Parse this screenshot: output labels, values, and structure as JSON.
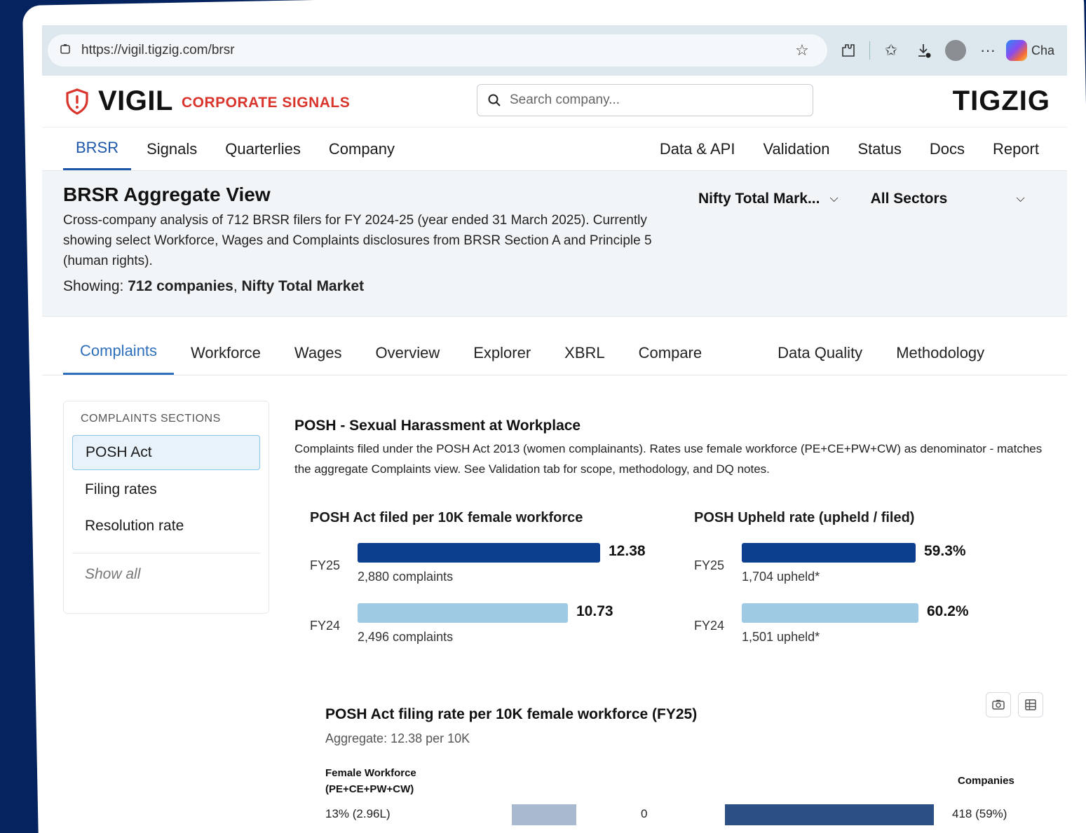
{
  "browser": {
    "url": "https://vigil.tigzig.com/brsr",
    "copilot_label": "Cha"
  },
  "header": {
    "brand_name": "VIGIL",
    "brand_tagline": "CORPORATE SIGNALS",
    "search_placeholder": "Search company...",
    "right_logo": "TIGZIG"
  },
  "nav": {
    "left": [
      "BRSR",
      "Signals",
      "Quarterlies",
      "Company"
    ],
    "right": [
      "Data & API",
      "Validation",
      "Status",
      "Docs",
      "Report"
    ],
    "active": "BRSR"
  },
  "page": {
    "title": "BRSR Aggregate View",
    "description": "Cross-company analysis of 712 BRSR filers for FY 2024-25 (year ended 31 March 2025). Currently showing select Workforce, Wages and Complaints disclosures from BRSR Section A and Principle 5 (human rights).",
    "showing_prefix": "Showing:",
    "showing_count": "712 companies",
    "showing_index": "Nifty Total Market",
    "index_dropdown": "Nifty Total Mark...",
    "sector_dropdown": "All Sectors"
  },
  "tabs": {
    "items": [
      "Complaints",
      "Workforce",
      "Wages",
      "Overview",
      "Explorer",
      "XBRL",
      "Compare",
      "Data Quality",
      "Methodology"
    ],
    "active": "Complaints"
  },
  "sidebar": {
    "heading": "COMPLAINTS SECTIONS",
    "items": [
      "POSH Act",
      "Filing rates",
      "Resolution rate"
    ],
    "active": "POSH Act",
    "show_all": "Show all"
  },
  "section": {
    "title": "POSH - Sexual Harassment at Workplace",
    "description": "Complaints filed under the POSH Act 2013 (women complainants). Rates use female workforce (PE+CE+PW+CW) as denominator - matches the aggregate Complaints view. See Validation tab for scope, methodology, and DQ notes."
  },
  "colors": {
    "accent": "#1d56a8",
    "brand_red": "#d9352c",
    "bar_dark": "#0d3f8f",
    "bar_light": "#9ecbe3",
    "bar_grey": "#a9b9cf",
    "bar_navy": "#2c4f86"
  },
  "chart_data": [
    {
      "type": "bar",
      "title": "POSH Act filed per 10K female workforce",
      "categories": [
        "FY25",
        "FY24"
      ],
      "values": [
        12.38,
        10.73
      ],
      "value_labels": [
        "12.38",
        "10.73"
      ],
      "sublabels": [
        "2,880 complaints",
        "2,496 complaints"
      ],
      "max": 12.38
    },
    {
      "type": "bar",
      "title": "POSH Upheld rate (upheld / filed)",
      "categories": [
        "FY25",
        "FY24"
      ],
      "values": [
        59.3,
        60.2
      ],
      "value_labels": [
        "59.3%",
        "60.2%"
      ],
      "sublabels": [
        "1,704 upheld*",
        "1,501 upheld*"
      ],
      "max": 60.2
    },
    {
      "type": "bar",
      "title": "POSH Act filing rate per 10K female workforce (FY25)",
      "subtitle": "Aggregate: 12.38 per 10K",
      "left_header": "Female Workforce (PE+CE+PW+CW)",
      "right_header": "Companies",
      "rows": [
        {
          "label": "13% (2.96L)",
          "value": 0,
          "value_label": "0",
          "companies": "418 (59%)",
          "left_share": 0.13,
          "right_share": 0.59
        }
      ]
    }
  ]
}
